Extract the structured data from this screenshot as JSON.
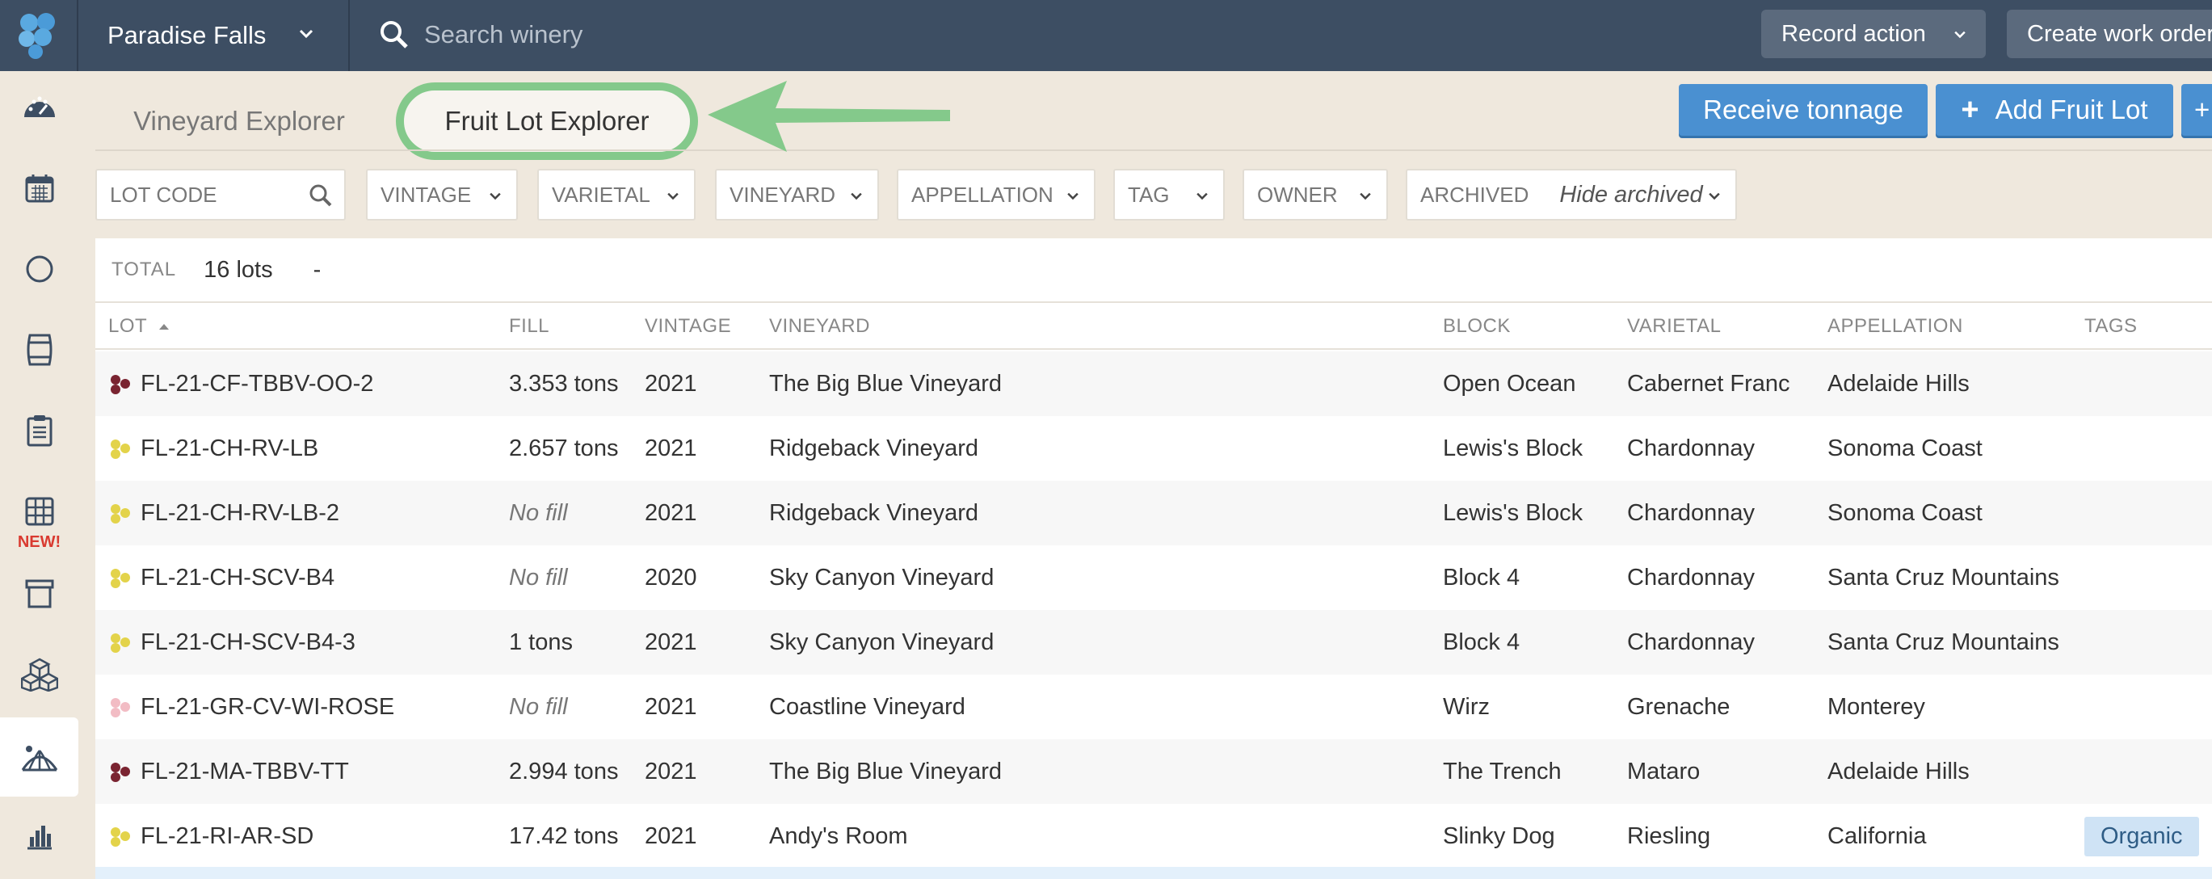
{
  "topbar": {
    "winery": "Paradise Falls",
    "search_placeholder": "Search winery",
    "record_action": "Record action",
    "create_work_order": "Create work order"
  },
  "sidebar": {
    "items": [
      "dashboard",
      "calendar",
      "circle",
      "barrel",
      "clipboard",
      "grid",
      "bin",
      "cubes",
      "vineyard",
      "chart"
    ],
    "new_badge": "NEW!"
  },
  "tabs": {
    "vineyard_explorer": "Vineyard Explorer",
    "fruit_lot_explorer": "Fruit Lot Explorer"
  },
  "actions": {
    "receive_tonnage": "Receive tonnage",
    "add_fruit_lot": "Add Fruit Lot",
    "extra_plus": "+"
  },
  "filters": {
    "lot_code_placeholder": "LOT CODE",
    "vintage": "VINTAGE",
    "varietal": "VARIETAL",
    "vineyard": "VINEYARD",
    "appellation": "APPELLATION",
    "tag": "TAG",
    "owner": "OWNER",
    "archived_label": "ARCHIVED",
    "archived_value": "Hide archived"
  },
  "summary": {
    "total_label": "TOTAL",
    "total_value": "16 lots",
    "dash": "-"
  },
  "table": {
    "headers": {
      "lot": "LOT",
      "fill": "FILL",
      "vintage": "VINTAGE",
      "vineyard": "VINEYARD",
      "block": "BLOCK",
      "varietal": "VARIETAL",
      "appellation": "APPELLATION",
      "tags": "TAGS"
    },
    "rows": [
      {
        "lot": "FL-21-CF-TBBV-OO-2",
        "fill": "3.353 tons",
        "vintage": "2021",
        "vineyard": "The Big Blue Vineyard",
        "block": "Open Ocean",
        "varietal": "Cabernet Franc",
        "appellation": "Adelaide Hills",
        "tag": "",
        "grape_color": "#7a2431"
      },
      {
        "lot": "FL-21-CH-RV-LB",
        "fill": "2.657 tons",
        "vintage": "2021",
        "vineyard": "Ridgeback Vineyard",
        "block": "Lewis's Block",
        "varietal": "Chardonnay",
        "appellation": "Sonoma Coast",
        "tag": "",
        "grape_color": "#e3d34a"
      },
      {
        "lot": "FL-21-CH-RV-LB-2",
        "fill": "No fill",
        "vintage": "2021",
        "vineyard": "Ridgeback Vineyard",
        "block": "Lewis's Block",
        "varietal": "Chardonnay",
        "appellation": "Sonoma Coast",
        "tag": "",
        "grape_color": "#e3d34a"
      },
      {
        "lot": "FL-21-CH-SCV-B4",
        "fill": "No fill",
        "vintage": "2020",
        "vineyard": "Sky Canyon Vineyard",
        "block": "Block 4",
        "varietal": "Chardonnay",
        "appellation": "Santa Cruz Mountains",
        "tag": "",
        "grape_color": "#e3d34a"
      },
      {
        "lot": "FL-21-CH-SCV-B4-3",
        "fill": "1 tons",
        "vintage": "2021",
        "vineyard": "Sky Canyon Vineyard",
        "block": "Block 4",
        "varietal": "Chardonnay",
        "appellation": "Santa Cruz Mountains",
        "tag": "",
        "grape_color": "#e3d34a"
      },
      {
        "lot": "FL-21-GR-CV-WI-ROSE",
        "fill": "No fill",
        "vintage": "2021",
        "vineyard": "Coastline Vineyard",
        "block": "Wirz",
        "varietal": "Grenache",
        "appellation": "Monterey",
        "tag": "",
        "grape_color": "#f2bcc4"
      },
      {
        "lot": "FL-21-MA-TBBV-TT",
        "fill": "2.994 tons",
        "vintage": "2021",
        "vineyard": "The Big Blue Vineyard",
        "block": "The Trench",
        "varietal": "Mataro",
        "appellation": "Adelaide Hills",
        "tag": "",
        "grape_color": "#7a2431"
      },
      {
        "lot": "FL-21-RI-AR-SD",
        "fill": "17.42 tons",
        "vintage": "2021",
        "vineyard": "Andy's Room",
        "block": "Slinky Dog",
        "varietal": "Riesling",
        "appellation": "California",
        "tag": "Organic",
        "grape_color": "#e3d34a"
      }
    ]
  }
}
